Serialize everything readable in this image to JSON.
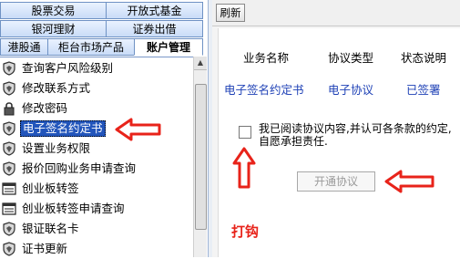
{
  "left_panel": {
    "tabs_row1": [
      {
        "label": "股票交易"
      },
      {
        "label": "开放式基金"
      }
    ],
    "tabs_row2": [
      {
        "label": "银河理财"
      },
      {
        "label": "证券出借"
      }
    ],
    "tabs_row3": [
      {
        "label": "港股通"
      },
      {
        "label": "柜台市场产品"
      },
      {
        "label": "账户管理"
      }
    ],
    "active_tab": "账户管理",
    "menu_items": [
      {
        "label": "查询客户风险级别",
        "icon": "shield-icon"
      },
      {
        "label": "修改联系方式",
        "icon": "shield-icon"
      },
      {
        "label": "修改密码",
        "icon": "padlock-icon"
      },
      {
        "label": "电子签名约定书",
        "icon": "shield-icon",
        "selected": true
      },
      {
        "label": "设置业务权限",
        "icon": "shield-icon"
      },
      {
        "label": "报价回购业务申请查询",
        "icon": "shield-icon"
      },
      {
        "label": "创业板转签",
        "icon": "document-icon"
      },
      {
        "label": "创业板转签申请查询",
        "icon": "document-icon"
      },
      {
        "label": "银证联名卡",
        "icon": "shield-icon"
      },
      {
        "label": "证书更新",
        "icon": "shield-icon"
      }
    ]
  },
  "right_panel": {
    "refresh_label": "刷新",
    "table": {
      "headers": [
        "业务名称",
        "协议类型",
        "状态说明"
      ],
      "row": [
        "电子签名约定书",
        "电子协议",
        "已签署"
      ]
    },
    "agree_text": "我已阅读协议内容,并认可各条款的约定,自愿承担责任.",
    "agree_checked": false,
    "open_button_label": "开通协议",
    "annotation_check_label": "打钩"
  },
  "colors": {
    "selection": "#2255bb",
    "link_text": "#1c3fb5",
    "arrow": "#e8231a",
    "tab_border": "#6f92c4"
  }
}
